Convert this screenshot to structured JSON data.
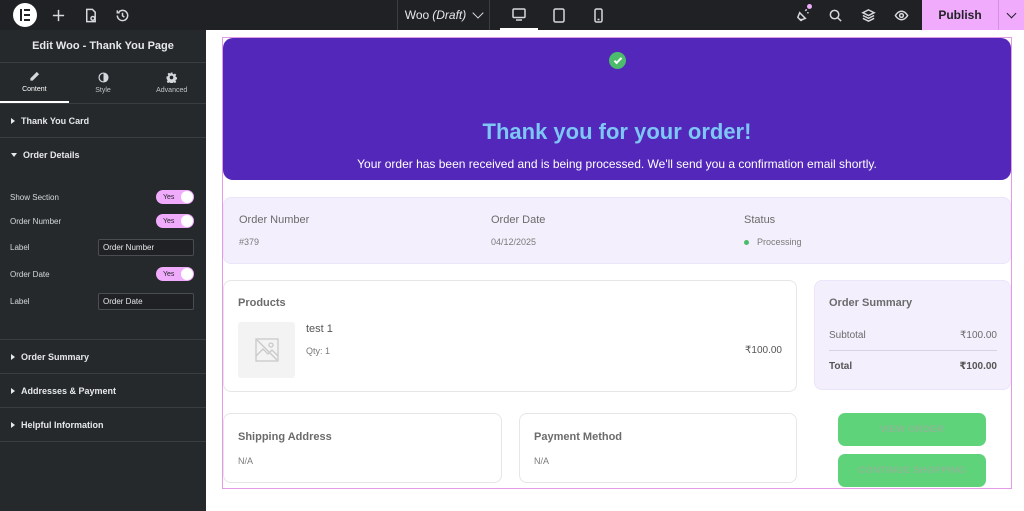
{
  "topbar": {
    "document_name": "Woo",
    "document_status": "(Draft)",
    "publish_label": "Publish",
    "icons": [
      "elementor-logo-icon",
      "plus-icon",
      "page-settings-icon",
      "history-icon",
      "chevron-down-icon",
      "desktop-icon",
      "tablet-icon",
      "mobile-icon",
      "notifications-icon",
      "search-icon",
      "layers-icon",
      "preview-eye-icon"
    ],
    "accent_color": "#f0abfc"
  },
  "sidebar": {
    "panel_title": "Edit Woo - Thank You Page",
    "tabs": [
      {
        "label": "Content",
        "icon": "pencil-icon",
        "active": true
      },
      {
        "label": "Style",
        "icon": "half-circle-icon",
        "active": false
      },
      {
        "label": "Advanced",
        "icon": "gear-icon",
        "active": false
      }
    ],
    "sections": {
      "thank_you_card": "Thank You Card",
      "order_details": "Order Details",
      "order_summary": "Order Summary",
      "addresses_payment": "Addresses & Payment",
      "helpful_information": "Helpful Information"
    },
    "controls": {
      "show_section": {
        "label": "Show Section",
        "value": "Yes"
      },
      "order_number": {
        "label": "Order Number",
        "value": "Yes"
      },
      "order_number_label": {
        "label": "Label",
        "value": "Order Number"
      },
      "order_date": {
        "label": "Order Date",
        "value": "Yes"
      },
      "order_date_label": {
        "label": "Label",
        "value": "Order Date"
      }
    }
  },
  "canvas": {
    "hero": {
      "title": "Thank you for your order!",
      "message": "Your order has been received and is being processed. We'll send you a confirmation email shortly.",
      "background": "#5327b9",
      "title_color": "#7dc6f5"
    },
    "details": {
      "order_number_label": "Order Number",
      "order_number": "#379",
      "order_date_label": "Order Date",
      "order_date": "04/12/2025",
      "status_label": "Status",
      "status": "Processing",
      "status_color": "#4cbb6c"
    },
    "products": {
      "heading": "Products",
      "items": [
        {
          "name": "test 1",
          "qty": "Qty: 1",
          "price": "₹100.00"
        }
      ]
    },
    "summary": {
      "heading": "Order Summary",
      "subtotal_label": "Subtotal",
      "subtotal": "₹100.00",
      "total_label": "Total",
      "total": "₹100.00"
    },
    "shipping": {
      "heading": "Shipping Address",
      "value": "N/A"
    },
    "payment": {
      "heading": "Payment Method",
      "value": "N/A"
    },
    "buttons": {
      "view_order": "VIEW ORDER",
      "continue_shopping": "CONTINUE SHOPPING",
      "color": "#5fd37a"
    }
  }
}
